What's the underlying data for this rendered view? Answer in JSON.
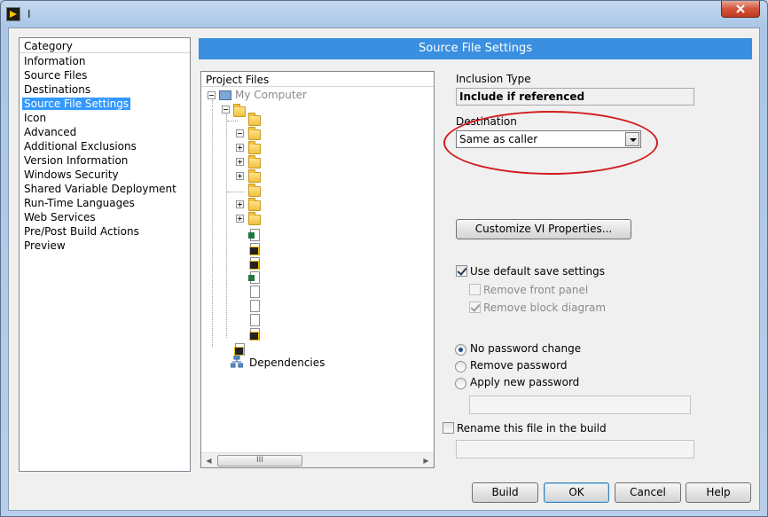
{
  "window": {
    "title": "I"
  },
  "category": {
    "header": "Category",
    "items": [
      "Information",
      "Source Files",
      "Destinations",
      "Source File Settings",
      "Icon",
      "Advanced",
      "Additional Exclusions",
      "Version Information",
      "Windows Security",
      "Shared Variable Deployment",
      "Run-Time Languages",
      "Web Services",
      "Pre/Post Build Actions",
      "Preview"
    ],
    "selected_index": 3
  },
  "section": {
    "title": "Source File Settings"
  },
  "project_files": {
    "header": "Project Files",
    "root_label": "My Computer",
    "dependencies_label": "Dependencies",
    "scroll_thumb_grip": "III"
  },
  "settings": {
    "inclusion_type_label": "Inclusion Type",
    "inclusion_type_value": "Include if referenced",
    "destination_label": "Destination",
    "destination_value": "Same as caller",
    "customize_button": "Customize VI Properties...",
    "use_default_save_label": "Use default save settings",
    "use_default_save_checked": true,
    "remove_front_panel_label": "Remove front panel",
    "remove_front_panel_checked": false,
    "remove_block_diagram_label": "Remove block diagram",
    "remove_block_diagram_checked": true,
    "password_options": [
      "No password change",
      "Remove password",
      "Apply new password"
    ],
    "password_selected": 0,
    "new_password_value": "",
    "rename_label": "Rename this file in the build",
    "rename_checked": false,
    "rename_value": ""
  },
  "footer": {
    "build": "Build",
    "ok": "OK",
    "cancel": "Cancel",
    "help": "Help"
  },
  "colors": {
    "section_header": "#3a8fe0",
    "selection": "#3399ff",
    "annotation": "#d01c1c"
  }
}
